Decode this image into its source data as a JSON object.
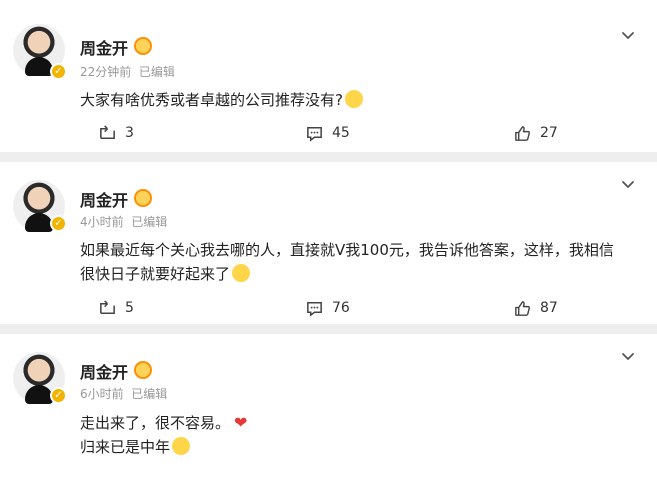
{
  "posts": [
    {
      "author": "周金开",
      "time": "22分钟前",
      "edited": "已编辑",
      "text": "大家有啥优秀或者卓越的公司推荐没有?",
      "reposts": "3",
      "comments": "45",
      "likes": "27"
    },
    {
      "author": "周金开",
      "time": "4小时前",
      "edited": "已编辑",
      "text_line1": "如果最近每个关心我去哪的人，直接就V我100元，我告诉他答案，这样，我相信",
      "text_line2": "很快日子就要好起来了",
      "reposts": "5",
      "comments": "76",
      "likes": "87"
    },
    {
      "author": "周金开",
      "time": "6小时前",
      "edited": "已编辑",
      "text_line1": "走出来了，很不容易。",
      "text_line2": "归来已是中年"
    }
  ],
  "icons": {
    "repost": "repost-icon",
    "comment": "comment-icon",
    "like": "like-icon",
    "more": "chevron-down-icon",
    "verified": "verified-icon",
    "vip": "vip-badge-icon"
  },
  "colors": {
    "separator": "#eeeeee",
    "meta": "#999999",
    "verified": "#f2b400",
    "heart": "#e53935"
  }
}
